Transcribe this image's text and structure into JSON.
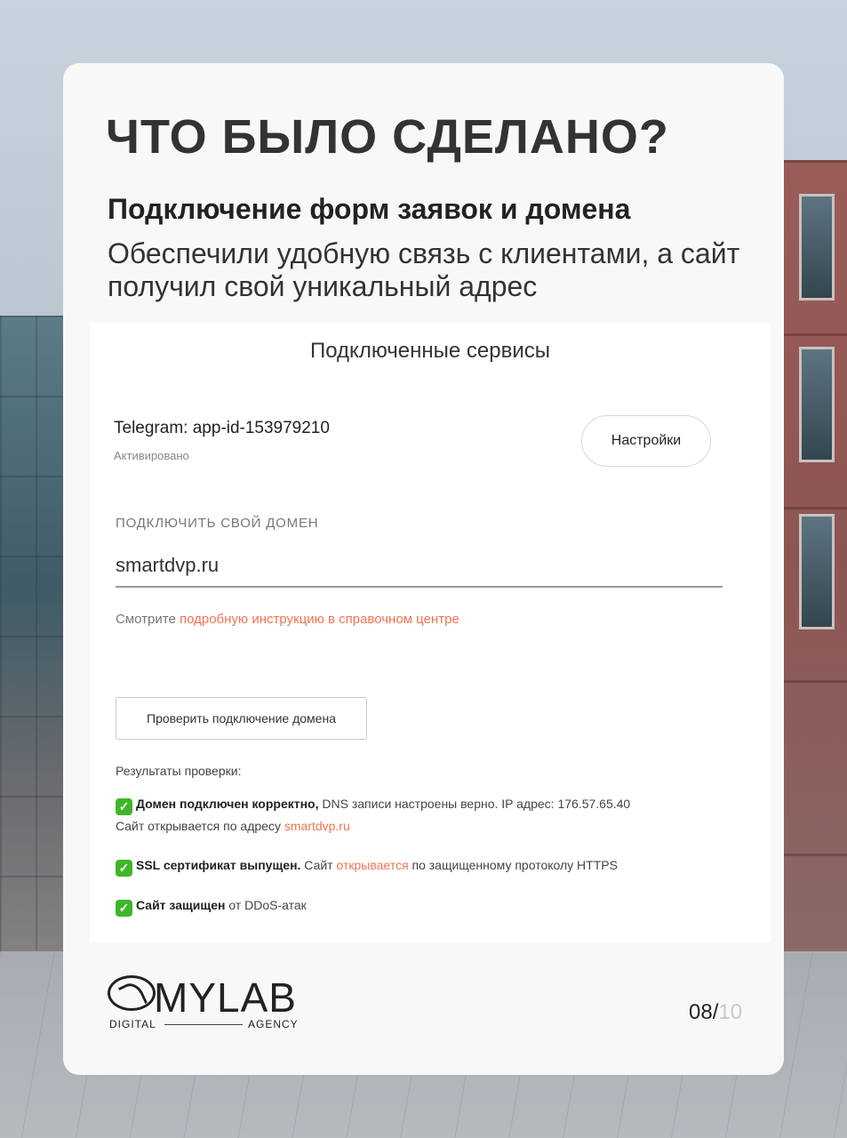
{
  "slide": {
    "heading": "ЧТО БЫЛО СДЕЛАНО?",
    "subheading": "Подключение форм заявок и домена",
    "description": "Обеспечили удобную связь с клиентами, а сайт получил свой уникальный адрес"
  },
  "panel": {
    "title": "Подключенные сервисы",
    "service": {
      "name": "Telegram: app-id-153979210",
      "status": "Активировано",
      "settings_label": "Настройки"
    },
    "domain": {
      "label": "ПОДКЛЮЧИТЬ СВОЙ ДОМЕН",
      "value": "smartdvp.ru",
      "hint_prefix": "Смотрите ",
      "hint_link": "подробную инструкцию в справочном центре"
    },
    "check_button_label": "Проверить подключение домена",
    "results_title": "Результаты проверки:",
    "results": [
      {
        "icon": "check-mark-icon",
        "bold": "Домен подключен корректно,",
        "text": " DNS записи настроены верно. IP адрес: 176.57.65.40",
        "line2_prefix": "Сайт открывается по адресу ",
        "line2_link": "smartdvp.ru"
      },
      {
        "icon": "check-mark-icon",
        "bold": "SSL сертификат выпущен.",
        "text_before": " Сайт ",
        "link": "открывается",
        "text_after": " по защищенному протоколу HTTPS"
      },
      {
        "icon": "check-mark-icon",
        "bold": "Сайт защищен",
        "text": " от DDoS-атак"
      }
    ]
  },
  "footer": {
    "logo_text": "MYLAB",
    "logo_left": "DIGITAL",
    "logo_right": "AGENCY",
    "page_current": "08/",
    "page_total": "10"
  },
  "colors": {
    "accent_link": "#f07452",
    "check_green": "#3fb62a"
  }
}
